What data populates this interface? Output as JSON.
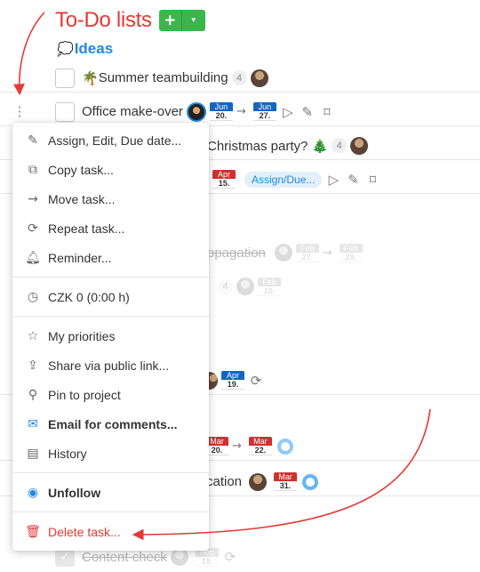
{
  "header": {
    "title": "To-Do lists",
    "add_label": "+",
    "dropdown_label": "▾"
  },
  "project": {
    "icon": "💭",
    "name": "Ideas"
  },
  "tasks": [
    {
      "emoji": "🌴",
      "text": "Summer teambuilding",
      "count": "4"
    },
    {
      "text": "Office make-over",
      "start": {
        "month": "Jun",
        "day": "20."
      },
      "end": {
        "month": "Jun",
        "day": "27."
      }
    },
    {
      "text": "Christmas party? 🎄",
      "count": "4"
    },
    {
      "due": {
        "month": "Apr",
        "day": "15."
      },
      "assign_label": "Assign/Due..."
    },
    {
      "text": "opagation",
      "start": {
        "month": "Feb",
        "day": "27."
      },
      "end": {
        "month": "Feb",
        "day": "28."
      }
    },
    {
      "count": "4",
      "due": {
        "month": "Feb",
        "day": "10."
      }
    },
    {
      "due": {
        "month": "Apr",
        "day": "19."
      }
    },
    {
      "start": {
        "month": "Mar",
        "day": "20."
      },
      "end": {
        "month": "Mar",
        "day": "22."
      }
    },
    {
      "text": "cation",
      "due": {
        "month": "Mar",
        "day": "31."
      }
    },
    {
      "text": "Content check",
      "due": {
        "month": "Aug",
        "day": "19."
      }
    }
  ],
  "menu": {
    "items": [
      {
        "icon": "pencil-icon",
        "glyph": "✎",
        "label": "Assign, Edit, Due date..."
      },
      {
        "icon": "copy-icon",
        "glyph": "⧉",
        "label": "Copy task..."
      },
      {
        "icon": "arrow-right-icon",
        "glyph": "→",
        "label": "Move task..."
      },
      {
        "icon": "repeat-icon",
        "glyph": "⟳",
        "label": "Repeat task..."
      },
      {
        "icon": "bell-icon",
        "glyph": "🔔︎",
        "label": "Reminder..."
      },
      {
        "icon": "clock-icon",
        "glyph": "◷",
        "label": "CZK 0 (0:00 h)"
      },
      {
        "icon": "star-icon",
        "glyph": "☆",
        "label": "My priorities"
      },
      {
        "icon": "share-icon",
        "glyph": "⇪",
        "label": "Share via public link..."
      },
      {
        "icon": "pin-icon",
        "glyph": "⚲",
        "label": "Pin to project"
      },
      {
        "icon": "email-icon",
        "glyph": "✉",
        "label": "Email for comments..."
      },
      {
        "icon": "history-icon",
        "glyph": "▤",
        "label": "History"
      },
      {
        "icon": "eye-icon",
        "glyph": "◉",
        "label": "Unfollow"
      },
      {
        "icon": "trash-icon",
        "glyph": "🗑︎",
        "label": "Delete task..."
      }
    ]
  },
  "colors": {
    "accent": "#e53935",
    "link": "#1e88e5",
    "add_button": "#3cb54a"
  }
}
